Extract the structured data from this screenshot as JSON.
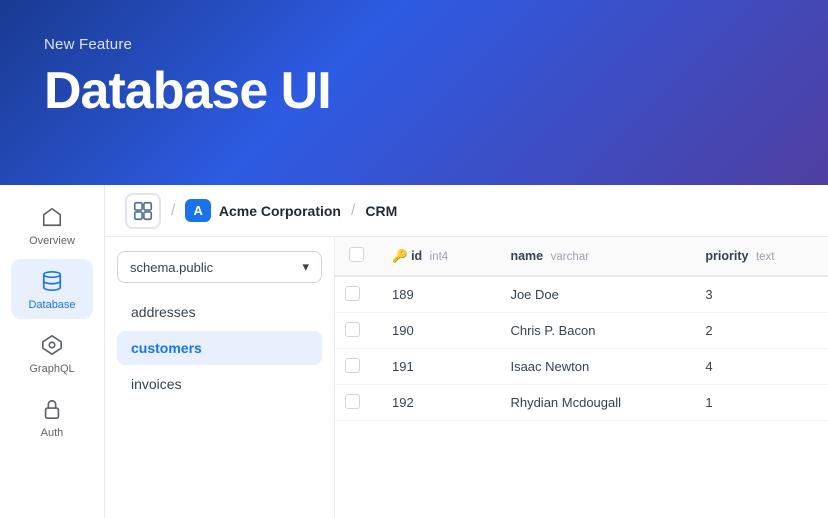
{
  "header": {
    "sub_label": "New Feature",
    "title": "Database UI"
  },
  "breadcrumb": {
    "org_name": "Acme Corporation",
    "db_name": "CRM"
  },
  "sidebar": {
    "items": [
      {
        "id": "overview",
        "label": "Overview",
        "active": false
      },
      {
        "id": "database",
        "label": "Database",
        "active": true
      },
      {
        "id": "graphql",
        "label": "GraphQL",
        "active": false
      },
      {
        "id": "auth",
        "label": "Auth",
        "active": false
      }
    ]
  },
  "schema_selector": {
    "value": "schema.public",
    "placeholder": "schema.public"
  },
  "table_list": {
    "items": [
      {
        "name": "addresses",
        "active": false
      },
      {
        "name": "customers",
        "active": true
      },
      {
        "name": "invoices",
        "active": false
      }
    ]
  },
  "data_table": {
    "columns": [
      {
        "name": "id",
        "type": "int4",
        "icon": "key"
      },
      {
        "name": "name",
        "type": "varchar",
        "icon": ""
      },
      {
        "name": "priority",
        "type": "text",
        "icon": ""
      }
    ],
    "rows": [
      {
        "id": "189",
        "name": "Joe Doe",
        "priority": "3"
      },
      {
        "id": "190",
        "name": "Chris P. Bacon",
        "priority": "2"
      },
      {
        "id": "191",
        "name": "Isaac Newton",
        "priority": "4"
      },
      {
        "id": "192",
        "name": "Rhydian Mcdougall",
        "priority": "1"
      }
    ]
  },
  "icons": {
    "overview": "⌂",
    "database": "🗄",
    "graphql": "✦",
    "auth": "🔒",
    "key": "🔑",
    "chevron_down": "⌄",
    "org_letter": "A"
  },
  "colors": {
    "accent": "#1a73e8",
    "header_start": "#1a3a8f",
    "header_end": "#4f3fa0",
    "active_bg": "#e8f0fe",
    "active_text": "#1a73e8"
  }
}
